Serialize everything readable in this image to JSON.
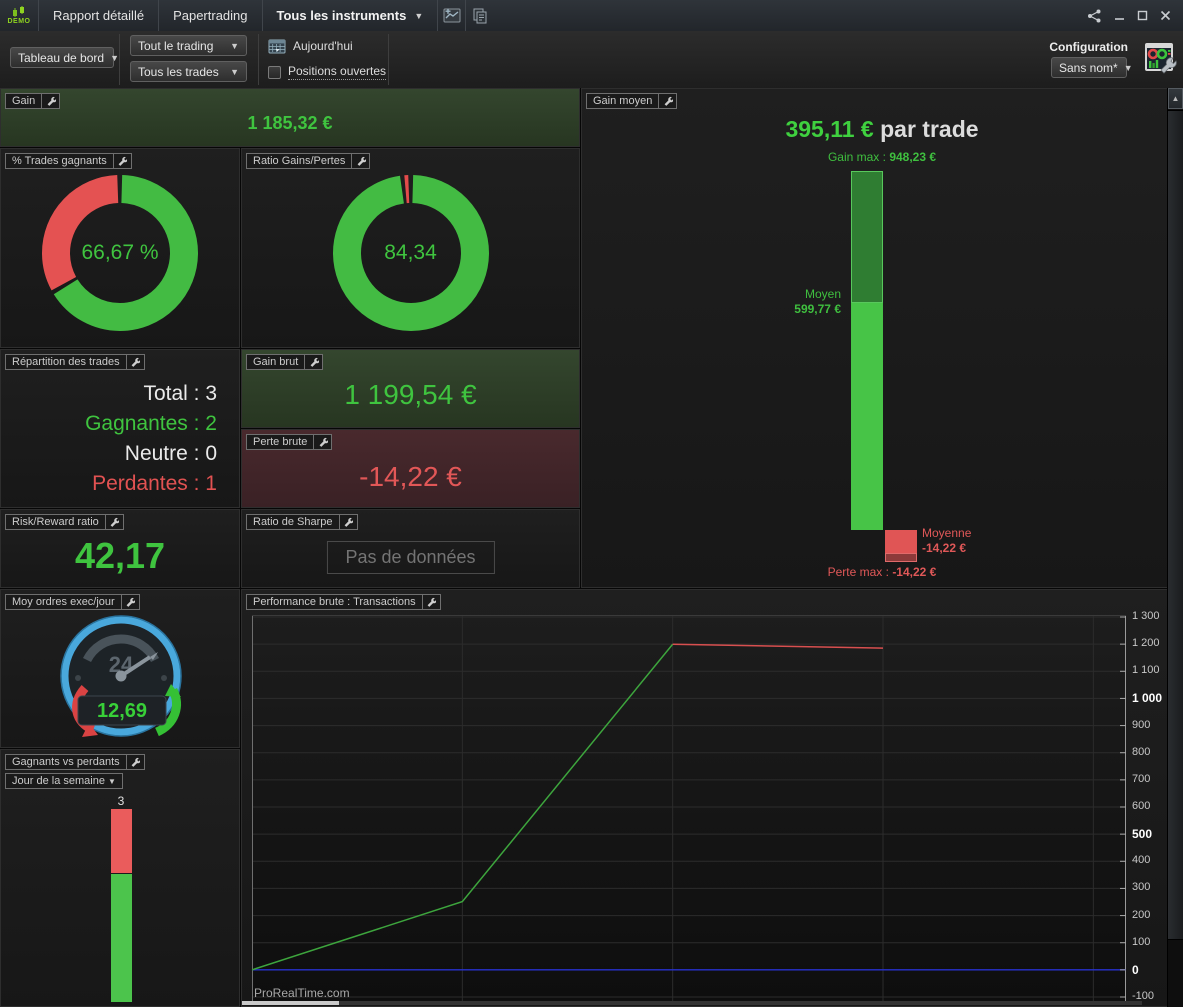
{
  "titlebar": {
    "logo": "DEMO",
    "tabs": [
      {
        "label": "Rapport détaillé"
      },
      {
        "label": "Papertrading"
      }
    ],
    "instruments_dropdown": "Tous les instruments"
  },
  "toolbar": {
    "view_dropdown": "Tableau de bord",
    "trading_dropdown": "Tout le trading",
    "trades_dropdown": "Tous les trades",
    "today_label": "Aujourd'hui",
    "open_positions_label": "Positions ouvertes",
    "configuration_label": "Configuration",
    "config_dropdown": "Sans nom*"
  },
  "colors": {
    "positive": "#3fc43f",
    "negative": "#e25555",
    "zero_line_blue": "#2731cf"
  },
  "panels": {
    "gain": {
      "title": "Gain",
      "value": "1 185,32 €"
    },
    "pct_trades": {
      "title": "% Trades gagnants"
    },
    "ratio_gains_pertes": {
      "title": "Ratio Gains/Pertes"
    },
    "gain_moyen": {
      "title": "Gain moyen",
      "value": "395,11 €",
      "suffix": " par trade",
      "gain_max_label": "Gain max : ",
      "gain_max_value": "948,23 €",
      "moyen_label": "Moyen",
      "moyen_value": "599,77 €",
      "moyenne_label": "Moyenne",
      "moyenne_value": "-14,22 €",
      "perte_max_label": "Perte max : ",
      "perte_max_value": "-14,22 €"
    },
    "repartition": {
      "title": "Répartition des trades",
      "rows": [
        {
          "text": "Total : 3",
          "type": "neutral"
        },
        {
          "text": "Gagnantes : 2",
          "type": "positive"
        },
        {
          "text": "Neutre : 0",
          "type": "neutral"
        },
        {
          "text": "Perdantes : 1",
          "type": "negative"
        }
      ]
    },
    "gain_brut": {
      "title": "Gain brut",
      "value": "1 199,54 €"
    },
    "perte_brute": {
      "title": "Perte brute",
      "value": "-14,22 €"
    },
    "risk_reward": {
      "title": "Risk/Reward ratio",
      "value": "42,17"
    },
    "sharpe": {
      "title": "Ratio de Sharpe",
      "message": "Pas de données"
    },
    "moy_ordres": {
      "title": "Moy ordres exec/jour",
      "value": "12,69",
      "dial_label": "24"
    },
    "gagnants_perdants": {
      "title": "Gagnants vs perdants",
      "dropdown": "Jour de la semaine"
    },
    "performance": {
      "title": "Performance brute : Transactions",
      "watermark": "ProRealTime.com"
    }
  },
  "chart_data": {
    "performance": {
      "type": "line",
      "title": "Performance brute : Transactions",
      "x_unit": "Transactions",
      "ylim": [
        -100,
        1300
      ],
      "grid": true,
      "y_ticks": [
        {
          "v": -100,
          "label": "-100",
          "bold": false
        },
        {
          "v": 0,
          "label": "0",
          "bold": true
        },
        {
          "v": 100,
          "label": "100",
          "bold": false
        },
        {
          "v": 200,
          "label": "200",
          "bold": false
        },
        {
          "v": 300,
          "label": "300",
          "bold": false
        },
        {
          "v": 400,
          "label": "400",
          "bold": false
        },
        {
          "v": 500,
          "label": "500",
          "bold": true
        },
        {
          "v": 600,
          "label": "600",
          "bold": false
        },
        {
          "v": 700,
          "label": "700",
          "bold": false
        },
        {
          "v": 800,
          "label": "800",
          "bold": false
        },
        {
          "v": 900,
          "label": "900",
          "bold": false
        },
        {
          "v": 1000,
          "label": "1 000",
          "bold": true
        },
        {
          "v": 1100,
          "label": "1 100",
          "bold": false
        },
        {
          "v": 1200,
          "label": "1 200",
          "bold": false
        },
        {
          "v": 1300,
          "label": "1 300",
          "bold": false
        }
      ],
      "x_gridlines": [
        1,
        2,
        3,
        4
      ],
      "series": [
        {
          "name": "performance cumulée (gains)",
          "color": "#3da53d",
          "points": [
            [
              0,
              0
            ],
            [
              1,
              251.31
            ],
            [
              2,
              1199.54
            ]
          ]
        },
        {
          "name": "performance cumulée (perte)",
          "color": "#d84f4f",
          "points": [
            [
              2,
              1199.54
            ],
            [
              3,
              1185.32
            ]
          ]
        }
      ],
      "zero_line": {
        "value": 0,
        "color": "#2731cf"
      }
    },
    "pct_trades_donut": {
      "type": "pie",
      "title": "% Trades gagnants",
      "center_text": "66,67 %",
      "slices": [
        {
          "label": "trades gagnants",
          "value": 66.67,
          "color": "#43bb43"
        },
        {
          "label": "trades perdants",
          "value": 33.33,
          "color": "#e45252"
        }
      ]
    },
    "ratio_donut": {
      "type": "pie",
      "title": "Ratio Gains/Pertes",
      "center_text": "84,34",
      "slices": [
        {
          "label": "gains",
          "value": 98.3,
          "color": "#43bb43"
        },
        {
          "label": "pertes",
          "value": 1.7,
          "color": "#e44b4b"
        }
      ]
    },
    "gain_moyen_bar": {
      "type": "bar",
      "title": "Gain moyen",
      "gain_max": 948.23,
      "moyen": 599.77,
      "moyenne": -14.22,
      "perte_max": -14.22
    },
    "gagnants_bar": {
      "type": "stacked-bar",
      "title": "Gagnants vs perdants",
      "grouping": "Jour de la semaine",
      "total": 3,
      "gagnants": 2,
      "perdants": 1,
      "total_label": "3"
    }
  }
}
